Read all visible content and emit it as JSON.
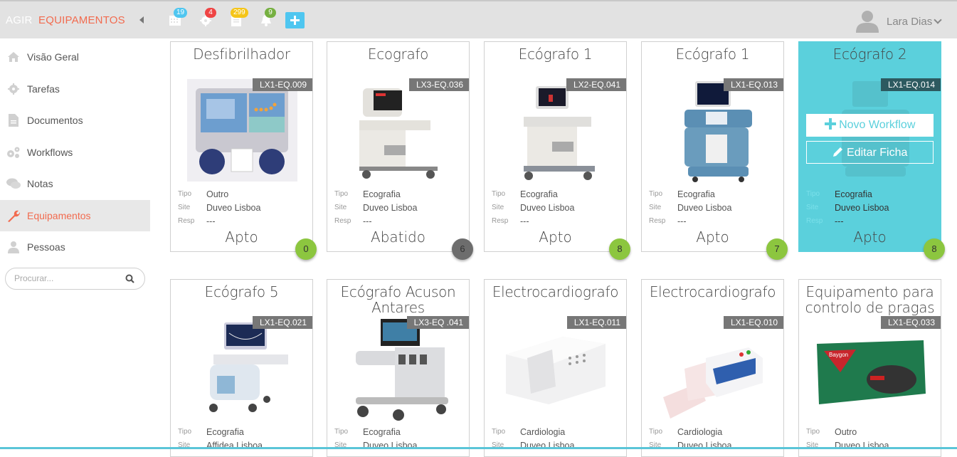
{
  "header": {
    "brand": "AGIR",
    "section": "EQUIPAMENTOS",
    "icons": [
      {
        "name": "calendar-icon",
        "badge": "19",
        "badge_color": "#4fc6f0"
      },
      {
        "name": "gear-icon",
        "badge": "4",
        "badge_color": "#ef4444"
      },
      {
        "name": "document-icon",
        "badge": "299",
        "badge_color": "#f5c518"
      },
      {
        "name": "bell-icon",
        "badge": "9",
        "badge_color": "#76b041"
      }
    ],
    "add_button": "plus-icon",
    "user": {
      "name": "Lara Dias"
    }
  },
  "sidebar": {
    "items": [
      {
        "label": "Visão Geral",
        "icon": "home-icon"
      },
      {
        "label": "Tarefas",
        "icon": "gear-icon"
      },
      {
        "label": "Documentos",
        "icon": "document-icon"
      },
      {
        "label": "Workflows",
        "icon": "gears-icon"
      },
      {
        "label": "Notas",
        "icon": "comments-icon"
      },
      {
        "label": "Equipamentos",
        "icon": "wrench-icon",
        "active": true
      },
      {
        "label": "Pessoas",
        "icon": "user-icon"
      }
    ],
    "search": {
      "placeholder": "Procurar..."
    }
  },
  "labels": {
    "tipo": "Tipo",
    "site": "Site",
    "resp": "Resp"
  },
  "hover_actions": {
    "new_workflow": "Novo Workflow",
    "edit": "Editar Ficha"
  },
  "status_colors": {
    "green": "#8cc63f",
    "grey": "#6d6d6d"
  },
  "cards": [
    {
      "title": "Desfibrilhador",
      "code": "LX1-EQ.009",
      "tipo": "Outro",
      "site": "Duveo Lisboa",
      "resp": "---",
      "status": "Apto",
      "count": "0",
      "count_color": "green"
    },
    {
      "title": "Ecografo",
      "code": "LX3-EQ.036",
      "tipo": "Ecografia",
      "site": "Duveo Lisboa",
      "resp": "---",
      "status": "Abatido",
      "count": "6",
      "count_color": "grey"
    },
    {
      "title": "Ecógrafo 1",
      "code": "LX2-EQ.041",
      "tipo": "Ecografia",
      "site": "Duveo Lisboa",
      "resp": "---",
      "status": "Apto",
      "count": "8",
      "count_color": "green"
    },
    {
      "title": "Ecógrafo 1",
      "code": "LX1-EQ.013",
      "tipo": "Ecografia",
      "site": "Duveo Lisboa",
      "resp": "---",
      "status": "Apto",
      "count": "7",
      "count_color": "green"
    },
    {
      "title": "Ecógrafo 2",
      "code": "LX1-EQ.014",
      "tipo": "Ecografia",
      "site": "Duveo Lisboa",
      "resp": "---",
      "status": "Apto",
      "count": "8",
      "count_color": "green",
      "hover": true
    },
    {
      "title": "Ecógrafo 5",
      "code": "LX1-EQ.021",
      "tipo": "Ecografia",
      "site": "Affidea Lisboa"
    },
    {
      "title": "Ecógrafo Acuson Antares",
      "code": "LX3-EQ .041",
      "tipo": "Ecografia",
      "site": "Duveo Lisboa"
    },
    {
      "title": "Electrocardiografo",
      "code": "LX1-EQ.011",
      "tipo": "Cardiologia",
      "site": "Duveo Lisboa"
    },
    {
      "title": "Electrocardiografo",
      "code": "LX1-EQ.010",
      "tipo": "Cardiologia",
      "site": "Duveo Lisboa"
    },
    {
      "title": "Equipamento para controlo de pragas",
      "code": "LX1-EQ.033",
      "tipo": "Outro",
      "site": "Duveo Lisboa"
    }
  ]
}
